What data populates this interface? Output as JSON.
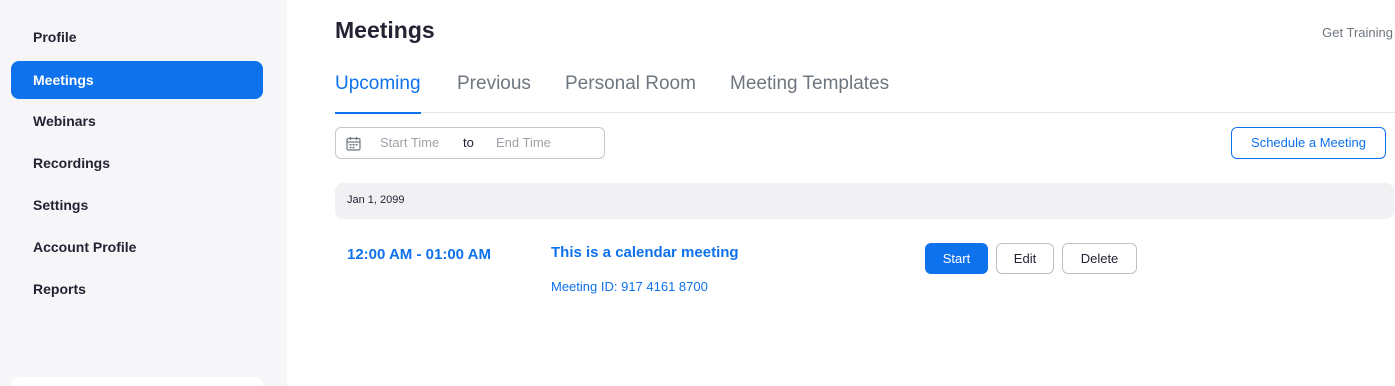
{
  "sidebar": {
    "items": [
      {
        "label": "Profile",
        "active": false
      },
      {
        "label": "Meetings",
        "active": true
      },
      {
        "label": "Webinars",
        "active": false
      },
      {
        "label": "Recordings",
        "active": false
      },
      {
        "label": "Settings",
        "active": false
      },
      {
        "label": "Account Profile",
        "active": false
      },
      {
        "label": "Reports",
        "active": false
      }
    ]
  },
  "header": {
    "title": "Meetings",
    "get_training": "Get Training"
  },
  "tabs": [
    {
      "label": "Upcoming",
      "active": true
    },
    {
      "label": "Previous",
      "active": false
    },
    {
      "label": "Personal Room",
      "active": false
    },
    {
      "label": "Meeting Templates",
      "active": false
    }
  ],
  "filter": {
    "start_placeholder": "Start Time",
    "separator": "to",
    "end_placeholder": "End Time",
    "icon": "calendar-icon"
  },
  "actions": {
    "schedule_label": "Schedule a Meeting"
  },
  "meetings": {
    "date": "Jan 1, 2099",
    "items": [
      {
        "time": "12:00 AM - 01:00 AM",
        "title": "This is a calendar meeting",
        "meeting_id": "Meeting ID: 917 4161 8700",
        "start_label": "Start",
        "edit_label": "Edit",
        "delete_label": "Delete"
      }
    ]
  },
  "colors": {
    "accent": "#0e72ed",
    "sidebar_bg": "#f6f6f9",
    "text": "#232333",
    "muted": "#6e7680"
  }
}
